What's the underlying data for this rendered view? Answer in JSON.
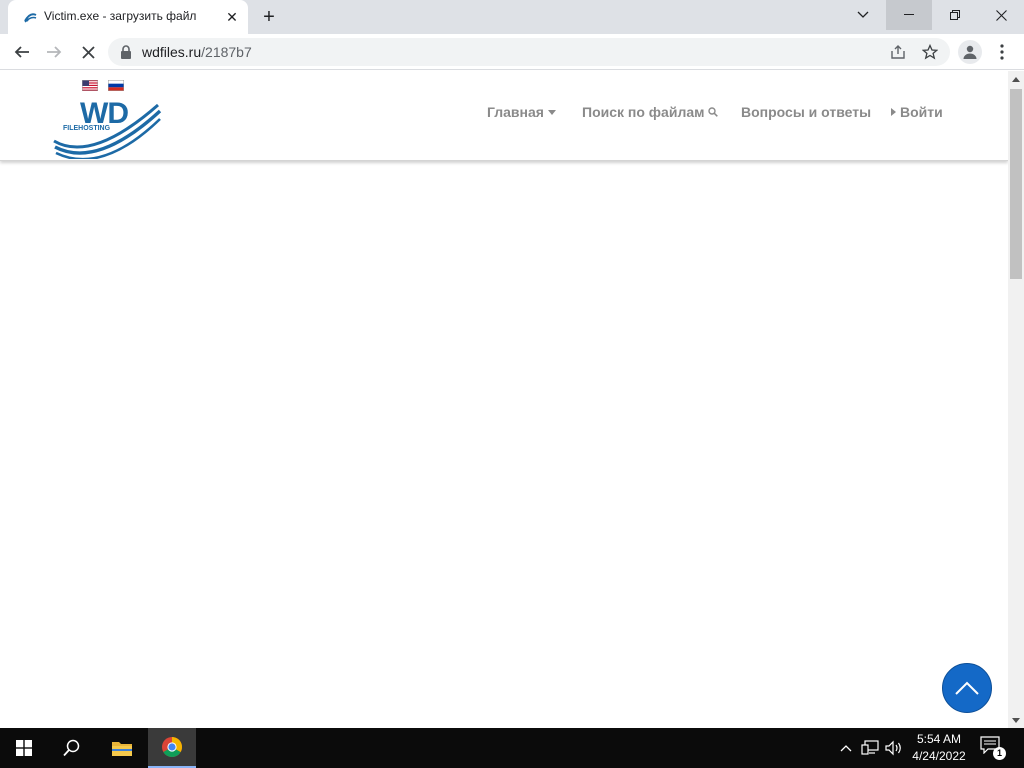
{
  "browser": {
    "tab": {
      "title": "Victim.exe - загрузить файл",
      "favicon": "wdfiles-favicon"
    },
    "address": {
      "host": "wdfiles.ru",
      "path": "/2187b7"
    },
    "icons": {
      "back": "back-arrow-icon",
      "forward": "forward-arrow-icon",
      "stop": "stop-loading-icon",
      "lock": "lock-icon",
      "share": "share-icon",
      "bookmark": "star-icon",
      "profile": "profile-icon",
      "menu": "more-vert-icon"
    },
    "window_controls": [
      "tab-search",
      "minimize",
      "restore",
      "close"
    ]
  },
  "site": {
    "logo": {
      "brand": "WD",
      "tagline": "FILEHOSTING",
      "color": "#1d6aa6"
    },
    "languages": [
      "us-flag",
      "ru-flag"
    ],
    "nav": {
      "home": "Главная",
      "search": "Поиск по файлам",
      "faq": "Вопросы и ответы",
      "login": "Войти"
    },
    "scroll_top_color": "#1469c7"
  },
  "taskbar": {
    "clock": {
      "time": "5:54 AM",
      "date": "4/24/2022"
    },
    "notifications": {
      "count": "1"
    },
    "pinned": [
      "start",
      "search",
      "file-explorer",
      "chrome"
    ]
  }
}
